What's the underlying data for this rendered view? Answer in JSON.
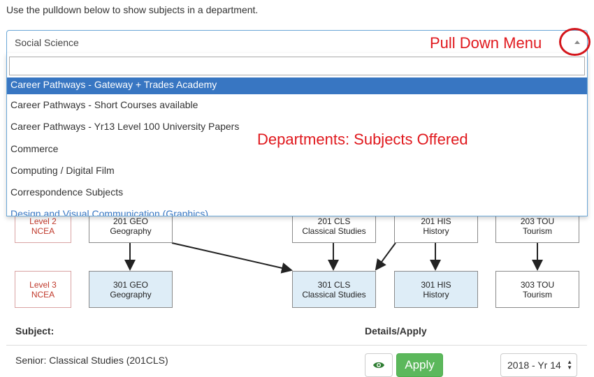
{
  "instruction": "Use the pulldown below to show subjects in a department.",
  "dropdown": {
    "selected": "Social Science",
    "search_value": "",
    "items": [
      {
        "label": "Career Pathways - Gateway + Trades Academy",
        "highlighted": true
      },
      {
        "label": "Career Pathways - Short Courses available",
        "highlighted": false
      },
      {
        "label": "Career Pathways - Yr13 Level 100 University Papers",
        "highlighted": false
      },
      {
        "label": "Commerce",
        "highlighted": false
      },
      {
        "label": "Computing / Digital Film",
        "highlighted": false
      },
      {
        "label": "Correspondence Subjects",
        "highlighted": false
      },
      {
        "label": "Design and Visual Communication (Graphics)",
        "highlighted": false
      }
    ]
  },
  "annotations": {
    "pulldown": "Pull Down Menu",
    "departments": "Departments: Subjects Offered"
  },
  "flowchart": {
    "level2": {
      "line1": "Level 2",
      "line2": "NCEA"
    },
    "level3": {
      "line1": "Level 3",
      "line2": "NCEA"
    },
    "row2": [
      {
        "code": "201 GEO",
        "name": "Geography"
      },
      {
        "code": "201 CLS",
        "name": "Classical Studies"
      },
      {
        "code": "201 HIS",
        "name": "History"
      },
      {
        "code": "203 TOU",
        "name": "Tourism"
      }
    ],
    "row3": [
      {
        "code": "301 GEO",
        "name": "Geography"
      },
      {
        "code": "301 CLS",
        "name": "Classical Studies"
      },
      {
        "code": "301 HIS",
        "name": "History"
      },
      {
        "code": "303 TOU",
        "name": "Tourism"
      }
    ]
  },
  "table": {
    "col_subject": "Subject:",
    "col_details": "Details/Apply",
    "rows": [
      {
        "subject": "Senior: Classical Studies (201CLS)",
        "apply_label": "Apply",
        "year": "2018 - Yr 14"
      }
    ]
  },
  "colors": {
    "highlight": "#3876c2",
    "apply_green": "#5cb85c",
    "annotation_red": "#e0181d",
    "node_blue": "#deedf7"
  }
}
